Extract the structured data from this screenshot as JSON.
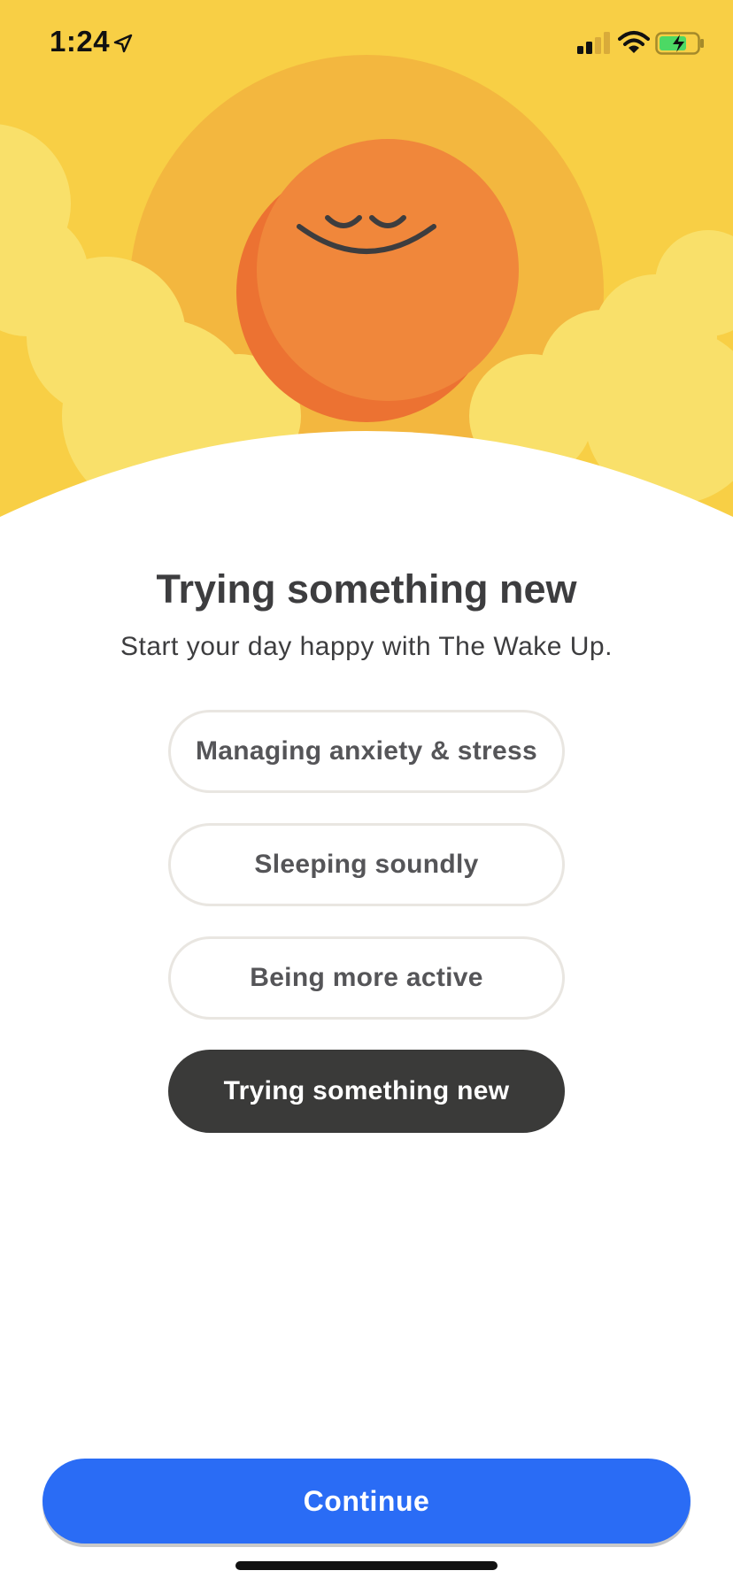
{
  "status_bar": {
    "time": "1:24",
    "icons": [
      "location-arrow-icon",
      "cellular-signal-icon",
      "wifi-icon",
      "battery-charging-icon"
    ]
  },
  "hero": {
    "colors": {
      "sky": "#f8cf45",
      "halo": "#f3b73f",
      "cloud": "#f9e06a",
      "sun": "#f0873b",
      "sun_shadow": "#ec7232",
      "face": "#3d3d3f"
    }
  },
  "content": {
    "title": "Trying something new",
    "subtitle": "Start your day happy with The Wake Up."
  },
  "options": [
    {
      "label": "Managing anxiety & stress",
      "selected": false
    },
    {
      "label": "Sleeping soundly",
      "selected": false
    },
    {
      "label": "Being more active",
      "selected": false
    },
    {
      "label": "Trying something new",
      "selected": true
    }
  ],
  "footer": {
    "continue_label": "Continue",
    "continue_color": "#2a6cf5"
  }
}
